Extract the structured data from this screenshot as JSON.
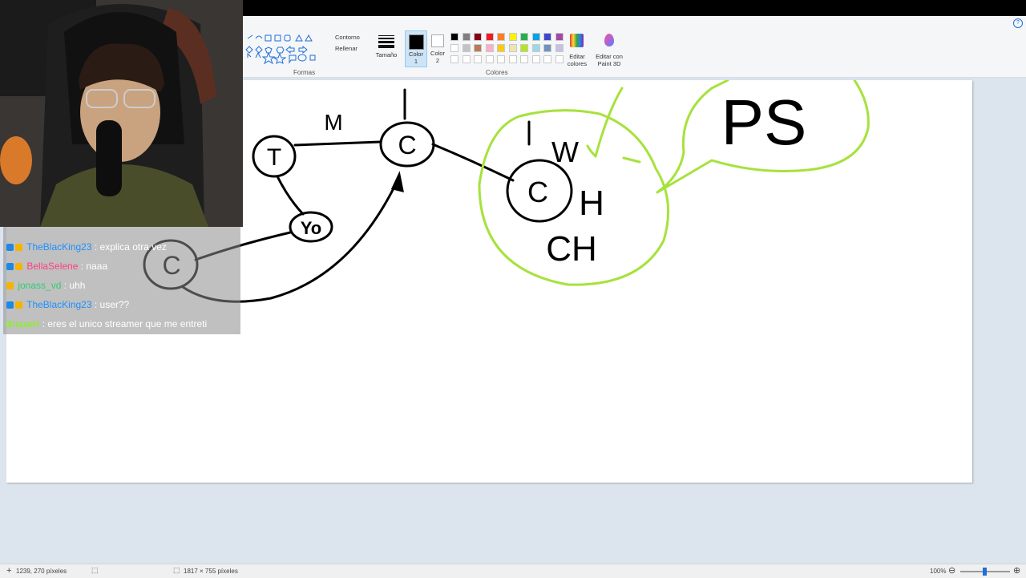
{
  "ribbon": {
    "shapes_group": "Formas",
    "outline": "Contorno",
    "fill": "Rellenar",
    "size": "Tamaño",
    "color1": "Color\n1",
    "color2": "Color\n2",
    "colors_group": "Colores",
    "edit_colors": "Editar\ncolores",
    "paint3d": "Editar con\nPaint 3D",
    "palette_row1": [
      "#000000",
      "#7f7f7f",
      "#880015",
      "#ed1c24",
      "#ff7f27",
      "#fff200",
      "#22b14c",
      "#00a2e8",
      "#3f48cc",
      "#a349a4"
    ],
    "palette_row2": [
      "#ffffff",
      "#c3c3c3",
      "#b97a57",
      "#ffaec9",
      "#ffc90e",
      "#efe4b0",
      "#b5e61d",
      "#99d9ea",
      "#7092be",
      "#c8bfe7"
    ]
  },
  "drawing": {
    "labels": [
      "M",
      "1",
      "1",
      "W",
      "H",
      "CH",
      "PS"
    ],
    "nodes": [
      "T",
      "C",
      "Yo",
      "C",
      "C"
    ],
    "accent_black": "#000000",
    "accent_green": "#a6e23c"
  },
  "chat": {
    "messages": [
      {
        "user": "TheBlacKing23",
        "user_color": "#1e90ff",
        "text": "explica otra vez"
      },
      {
        "user": "BellaSelene",
        "user_color": "#ff3f7f",
        "text": "naaa"
      },
      {
        "user": "jonass_vd",
        "user_color": "#2ecc71",
        "text": "uhh"
      },
      {
        "user": "TheBlacKing23",
        "user_color": "#1e90ff",
        "text": "user??"
      },
      {
        "user": "dinaxerr",
        "user_color": "#7cfc00",
        "text": "eres el unico streamer que me entreti"
      }
    ]
  },
  "status": {
    "cursor_pos": "1239, 270 píxeles",
    "canvas_size": "1817 × 755 píxeles",
    "zoom": "100%"
  }
}
